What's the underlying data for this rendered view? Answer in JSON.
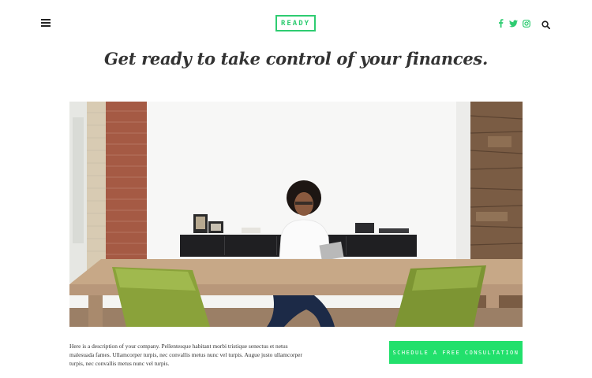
{
  "header": {
    "logo_text": "READY",
    "menu_icon": "hamburger-menu-icon",
    "socials": [
      {
        "name": "facebook",
        "icon": "facebook-icon"
      },
      {
        "name": "twitter",
        "icon": "twitter-icon"
      },
      {
        "name": "instagram",
        "icon": "instagram-icon"
      }
    ],
    "search_icon": "search-icon"
  },
  "hero": {
    "tagline": "Get ready to take control of your finances."
  },
  "footer": {
    "description": "Here is a description of your company. Pellentesque habitant morbi tristique senectus et netus malesuada fames. Ullamcorper turpis, nec convallis metus nunc vel turpis. Augue justo ullamcorper turpis, nec convallis metus nunc vel turpis.",
    "cta_label": "SCHEDULE A FREE CONSULTATION"
  },
  "colors": {
    "accent": "#2ecc71",
    "cta_background": "#22e06c",
    "text": "#333333"
  }
}
